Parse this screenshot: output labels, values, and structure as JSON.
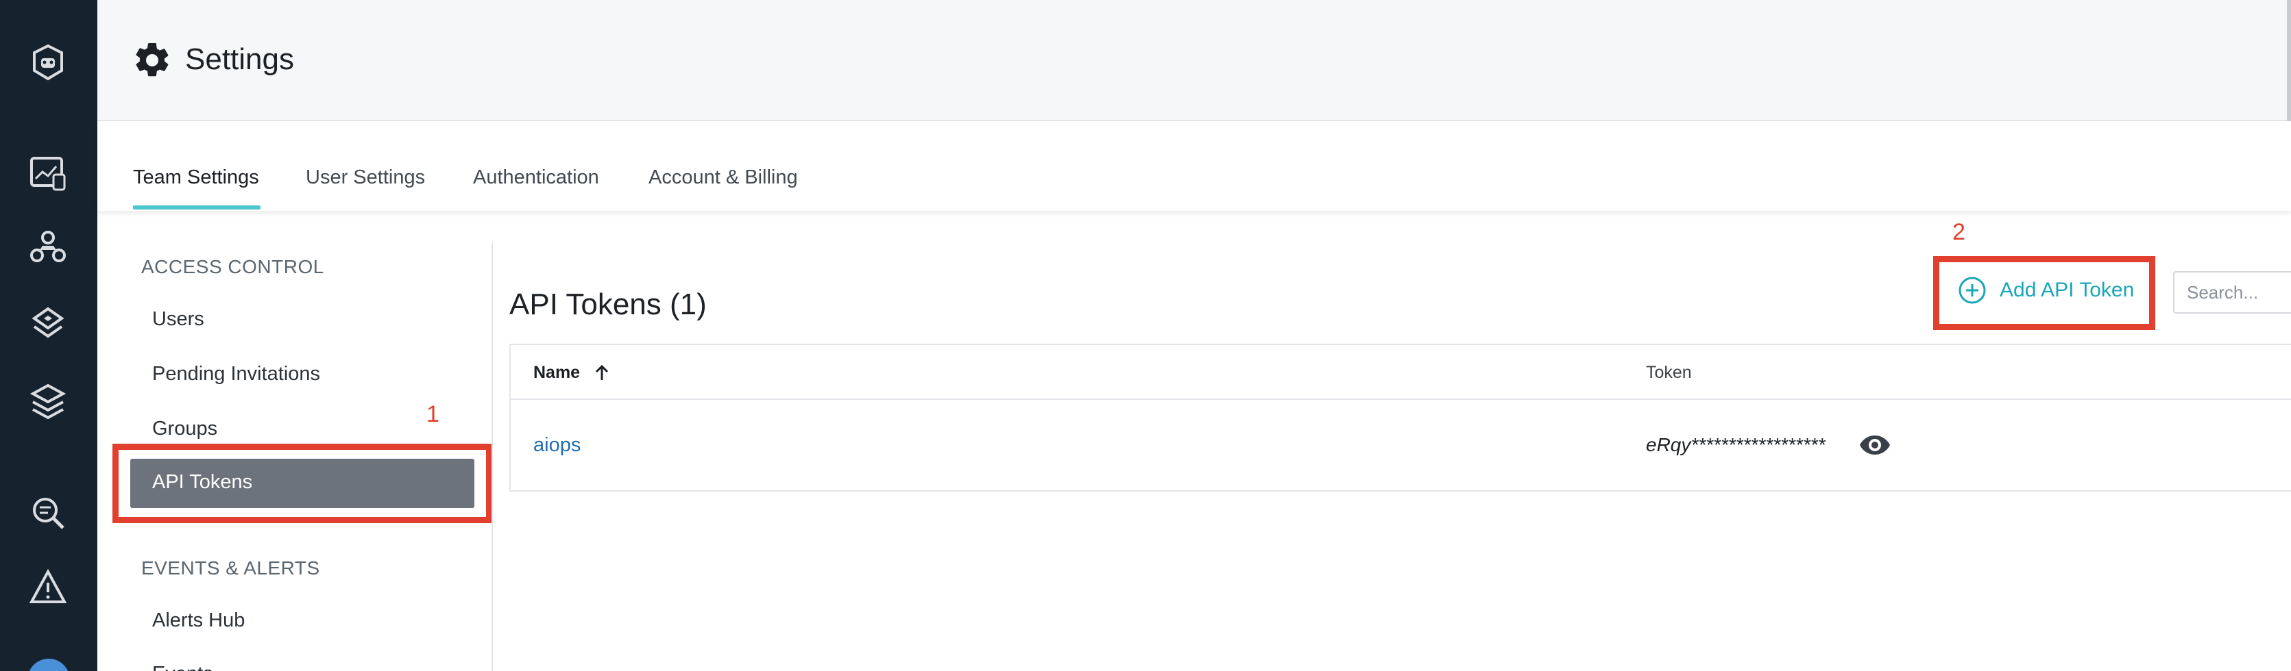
{
  "header": {
    "title": "Settings"
  },
  "tabs": [
    {
      "label": "Team Settings",
      "active": true
    },
    {
      "label": "User Settings"
    },
    {
      "label": "Authentication"
    },
    {
      "label": "Account & Billing"
    }
  ],
  "sidebar": {
    "sections": [
      {
        "heading": "ACCESS CONTROL",
        "items": [
          "Users",
          "Pending Invitations",
          "Groups",
          "API Tokens"
        ]
      },
      {
        "heading": "EVENTS & ALERTS",
        "items": [
          "Alerts Hub",
          "Events"
        ]
      }
    ],
    "active_item": "API Tokens"
  },
  "annotations": {
    "first": "1",
    "second": "2"
  },
  "main": {
    "title": "API Tokens (1)",
    "add_button": "Add API Token",
    "search_placeholder": "Search...",
    "table": {
      "columns": [
        "Name",
        "Token"
      ],
      "rows": [
        {
          "name": "aiops",
          "token": "eRqy******************"
        }
      ]
    }
  },
  "colors": {
    "accent": "#4bc6cf",
    "highlight": "#e2402e",
    "rail": "#16232e",
    "link": "#1f6fb2"
  },
  "icons": {
    "rail": [
      "logo-icon",
      "dashboard-icon",
      "infrastructure-icon",
      "integrations-icon",
      "layers-icon",
      "search-analytics-icon",
      "alert-triangle-icon"
    ],
    "header": "gear-icon",
    "add": "plus-circle-icon",
    "sort": "arrow-up-icon",
    "reveal": "eye-icon"
  }
}
